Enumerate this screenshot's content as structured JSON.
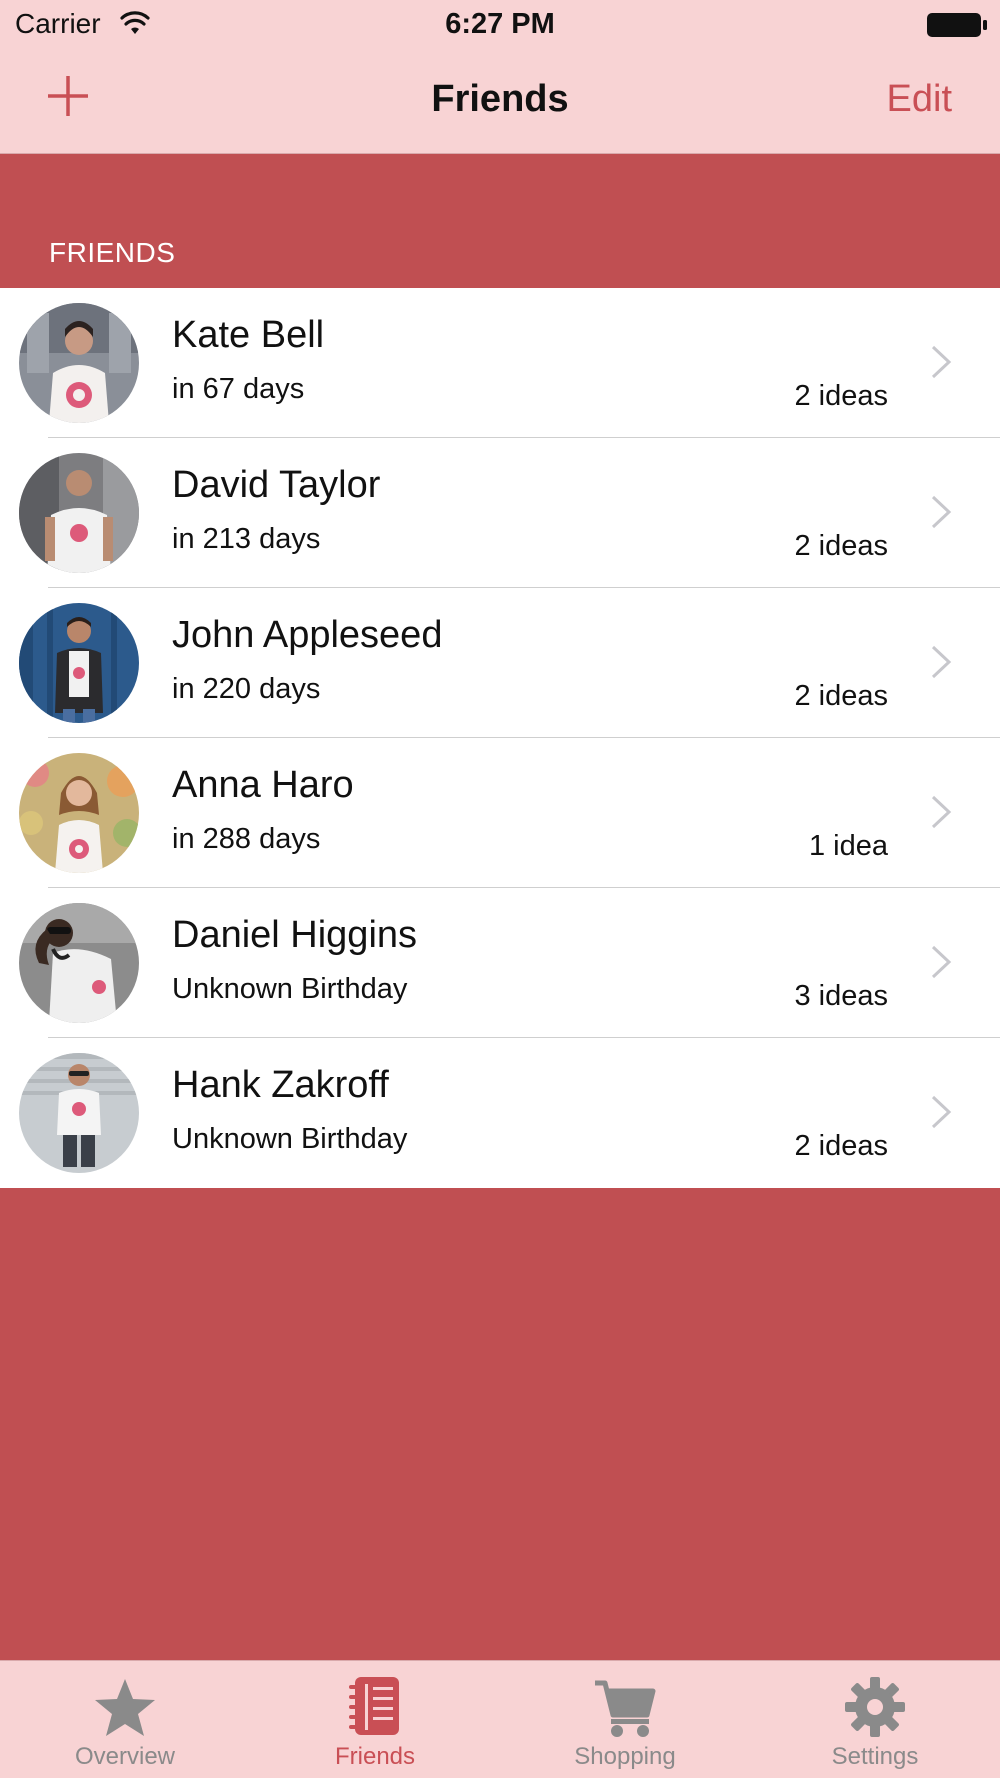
{
  "status_bar": {
    "carrier": "Carrier",
    "time": "6:27 PM"
  },
  "nav": {
    "title": "Friends",
    "add_icon": "plus-icon",
    "edit_label": "Edit"
  },
  "section": {
    "header": "FRIENDS"
  },
  "friends": [
    {
      "name": "Kate Bell",
      "subtitle": "in 67 days",
      "ideas": "2 ideas"
    },
    {
      "name": "David Taylor",
      "subtitle": "in 213 days",
      "ideas": "2 ideas"
    },
    {
      "name": "John Appleseed",
      "subtitle": "in 220 days",
      "ideas": "2 ideas"
    },
    {
      "name": "Anna Haro",
      "subtitle": "in 288 days",
      "ideas": "1 idea"
    },
    {
      "name": "Daniel Higgins",
      "subtitle": "Unknown Birthday",
      "ideas": "3 ideas"
    },
    {
      "name": "Hank Zakroff",
      "subtitle": "Unknown Birthday",
      "ideas": "2 ideas"
    }
  ],
  "tab_bar": {
    "tabs": [
      {
        "label": "Overview",
        "icon": "star-icon",
        "active": false
      },
      {
        "label": "Friends",
        "icon": "notebook-icon",
        "active": true
      },
      {
        "label": "Shopping",
        "icon": "cart-icon",
        "active": false
      },
      {
        "label": "Settings",
        "icon": "gear-icon",
        "active": false
      }
    ]
  },
  "colors": {
    "accent": "#c94f55",
    "bar_background": "#f8d3d4",
    "page_background": "#c04f52",
    "inactive_tab": "#8a8a8a"
  }
}
